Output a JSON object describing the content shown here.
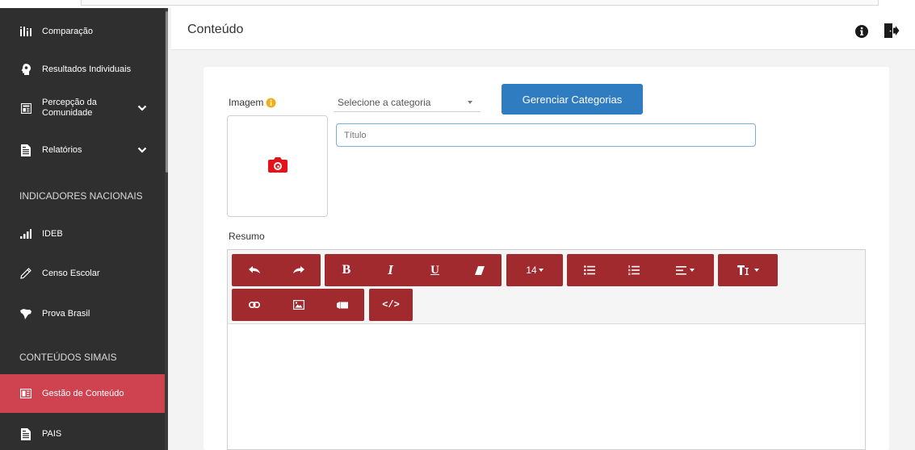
{
  "sidebar": {
    "items": [
      {
        "label": "Comparação",
        "icon": "bar-chart-icon"
      },
      {
        "label": "Resultados Individuais",
        "icon": "head-icon"
      },
      {
        "label": "Percepção da Comunidade",
        "icon": "newspaper-icon"
      },
      {
        "label": "Relatórios",
        "icon": "document-icon"
      },
      {
        "label": "IDEB",
        "icon": "signal-bars-icon"
      },
      {
        "label": "Censo Escolar",
        "icon": "pencil-icon"
      },
      {
        "label": "Prova Brasil",
        "icon": "map-icon"
      },
      {
        "label": "Gestão de Conteúdo",
        "icon": "newspaper-icon",
        "active": true
      },
      {
        "label": "PAIS",
        "icon": "document-icon"
      }
    ],
    "sections": {
      "nacionais": "INDICADORES NACIONAIS",
      "simais": "CONTEÚDOS SIMAIS"
    },
    "percepcao_line1": "Percepção da",
    "percepcao_line2": "Comunidade"
  },
  "header": {
    "title": "Conteúdo"
  },
  "form": {
    "image_label": "Imagem",
    "category_placeholder": "Selecione a categoria",
    "manage_button": "Gerenciar Categorias",
    "title_placeholder": "Título",
    "summary_label": "Resumo"
  },
  "editor": {
    "font_size": "14"
  },
  "colors": {
    "sidebar_bg": "#2f2f2f",
    "active_item": "#cf4350",
    "toolbar_button": "#a12a2e",
    "primary_button": "#2f7cc1",
    "camera_icon": "#e3131b"
  }
}
